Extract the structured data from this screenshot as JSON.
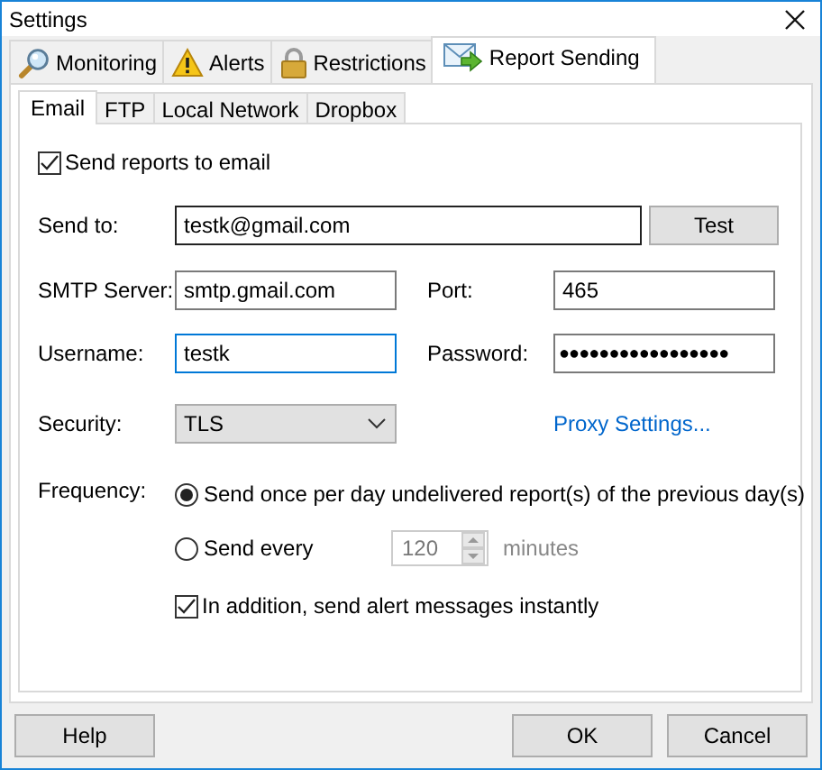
{
  "window": {
    "title": "Settings"
  },
  "tabs": [
    {
      "label": "Monitoring",
      "selected": false
    },
    {
      "label": "Alerts",
      "selected": false
    },
    {
      "label": "Restrictions",
      "selected": false
    },
    {
      "label": "Report Sending",
      "selected": true
    }
  ],
  "subtabs": [
    {
      "label": "Email",
      "selected": true
    },
    {
      "label": "FTP",
      "selected": false
    },
    {
      "label": "Local Network",
      "selected": false
    },
    {
      "label": "Dropbox",
      "selected": false
    }
  ],
  "send_reports": {
    "label": "Send reports to email",
    "checked": true
  },
  "send_to": {
    "label": "Send to:",
    "value": "testk@gmail.com",
    "button": "Test"
  },
  "smtp_server": {
    "label": "SMTP Server:",
    "value": "smtp.gmail.com",
    "focused": false
  },
  "port": {
    "label": "Port:",
    "value": "465",
    "focused": false
  },
  "username": {
    "label": "Username:",
    "value": "testk",
    "focused": true
  },
  "password": {
    "label": "Password:",
    "value": "●●●●●●●●●●●●●●●●●",
    "focused": false
  },
  "security": {
    "label": "Security:",
    "value": "TLS"
  },
  "proxy_link": "Proxy Settings...",
  "frequency": {
    "label": "Frequency:",
    "options": [
      {
        "label": "Send once per day undelivered report(s) of the previous day(s)",
        "selected": true
      },
      {
        "label": "Send every",
        "selected": false
      }
    ],
    "interval": {
      "value": "120",
      "unit": "minutes",
      "disabled": true
    }
  },
  "instant_alerts": {
    "label": "In addition, send alert messages instantly",
    "checked": true
  },
  "buttons": {
    "left": [
      "Help"
    ],
    "right": [
      "OK",
      "Cancel"
    ]
  }
}
